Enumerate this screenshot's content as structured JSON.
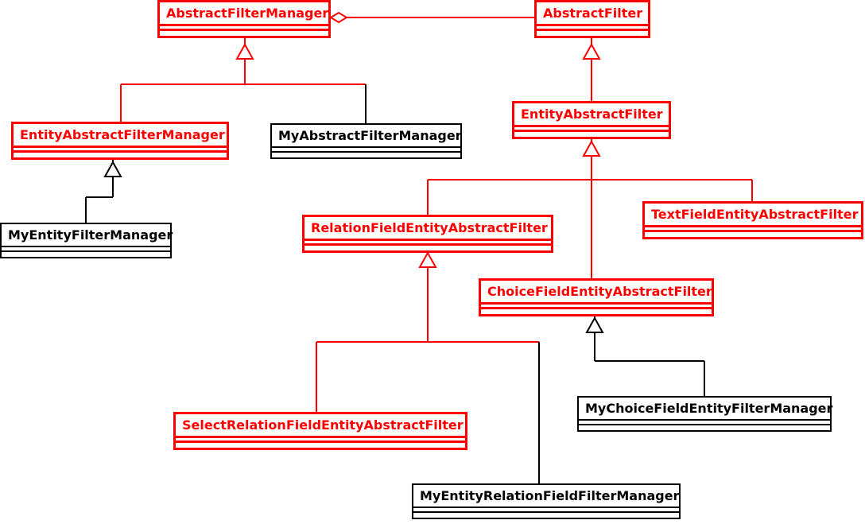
{
  "diagram": {
    "type": "uml-class-diagram",
    "classes": {
      "abstractFilterManager": {
        "name": "AbstractFilterManager",
        "abstract": true
      },
      "abstractFilter": {
        "name": "AbstractFilter",
        "abstract": true
      },
      "entityAbstractFilterManager": {
        "name": "EntityAbstractFilterManager",
        "abstract": true
      },
      "myAbstractFilterManager": {
        "name": "MyAbstractFilterManager",
        "abstract": false
      },
      "entityAbstractFilter": {
        "name": "EntityAbstractFilter",
        "abstract": true
      },
      "myEntityFilterManager": {
        "name": "MyEntityFilterManager",
        "abstract": false
      },
      "relationFieldEntityAbstractFilter": {
        "name": "RelationFieldEntityAbstractFilter",
        "abstract": true
      },
      "textFieldEntityAbstractFilter": {
        "name": "TextFieldEntityAbstractFilter",
        "abstract": true
      },
      "choiceFieldEntityAbstractFilter": {
        "name": "ChoiceFieldEntityAbstractFilter",
        "abstract": true
      },
      "selectRelationFieldEntityAbstractFilter": {
        "name": "SelectRelationFieldEntityAbstractFilter",
        "abstract": true
      },
      "myChoiceFieldEntityFilterManager": {
        "name": "MyChoiceFieldEntityFilterManager",
        "abstract": false
      },
      "myEntityRelationFieldFilterManager": {
        "name": "MyEntityRelationFieldFilterManager",
        "abstract": false
      }
    },
    "relationships": [
      {
        "from": "entityAbstractFilterManager",
        "to": "abstractFilterManager",
        "kind": "generalization"
      },
      {
        "from": "myAbstractFilterManager",
        "to": "abstractFilterManager",
        "kind": "generalization"
      },
      {
        "from": "myEntityFilterManager",
        "to": "entityAbstractFilterManager",
        "kind": "generalization"
      },
      {
        "from": "entityAbstractFilter",
        "to": "abstractFilter",
        "kind": "generalization"
      },
      {
        "from": "relationFieldEntityAbstractFilter",
        "to": "entityAbstractFilter",
        "kind": "generalization"
      },
      {
        "from": "choiceFieldEntityAbstractFilter",
        "to": "entityAbstractFilter",
        "kind": "generalization"
      },
      {
        "from": "textFieldEntityAbstractFilter",
        "to": "entityAbstractFilter",
        "kind": "generalization"
      },
      {
        "from": "selectRelationFieldEntityAbstractFilter",
        "to": "relationFieldEntityAbstractFilter",
        "kind": "generalization"
      },
      {
        "from": "myEntityRelationFieldFilterManager",
        "to": "relationFieldEntityAbstractFilter",
        "kind": "generalization"
      },
      {
        "from": "myChoiceFieldEntityFilterManager",
        "to": "choiceFieldEntityAbstractFilter",
        "kind": "generalization"
      },
      {
        "from": "abstractFilterManager",
        "to": "abstractFilter",
        "kind": "aggregation"
      }
    ]
  }
}
